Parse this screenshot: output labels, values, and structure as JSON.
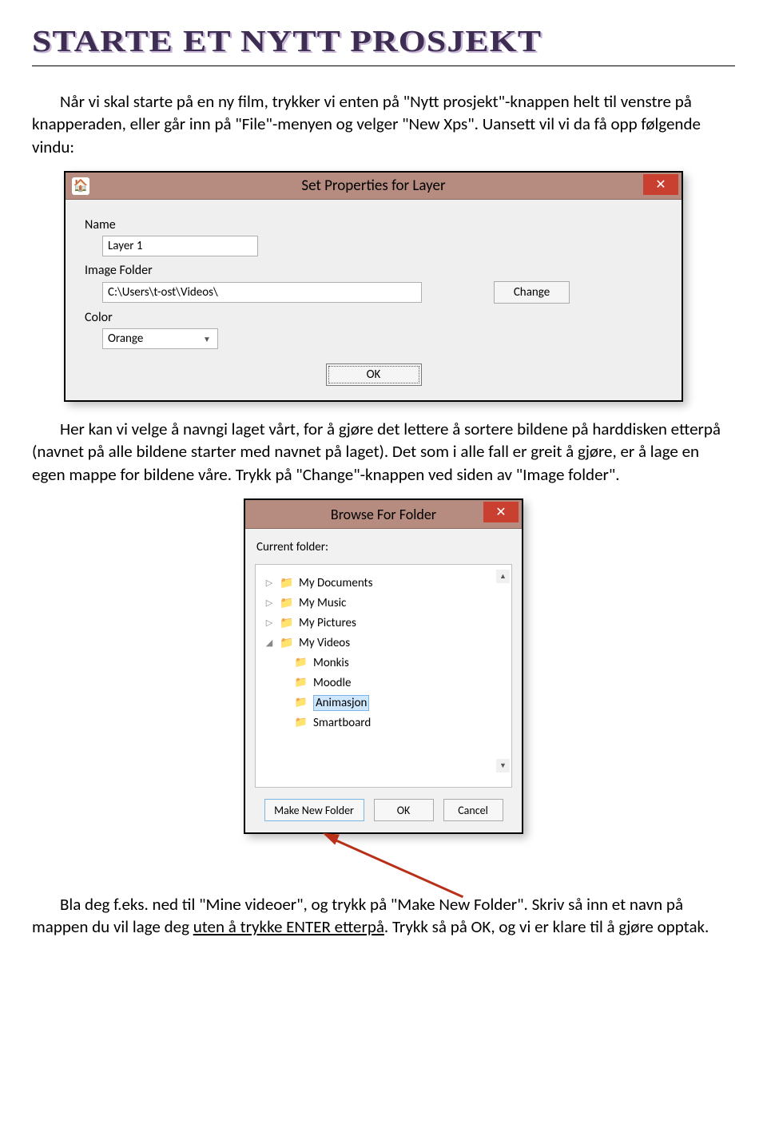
{
  "header": {
    "title": "STARTE ET NYTT PROSJEKT"
  },
  "para1": "Når vi skal starte på en ny film, trykker vi enten på \"Nytt prosjekt\"-knappen helt til venstre på knapperaden, eller går inn på \"File\"-menyen og velger \"New Xps\". Uansett vil vi da få opp følgende vindu:",
  "dialog1": {
    "title": "Set Properties for Layer",
    "close": "✕",
    "name_label": "Name",
    "name_value": "Layer 1",
    "folder_label": "Image Folder",
    "folder_value": "C:\\Users\\t-ost\\Videos\\",
    "change_btn": "Change",
    "color_label": "Color",
    "color_value": "Orange",
    "ok_btn": "OK"
  },
  "para2": "Her kan vi velge å navngi laget vårt, for å gjøre det lettere å sortere bildene på harddisken etterpå (navnet på alle bildene starter med navnet på laget). Det som i alle fall er greit å gjøre, er å lage en egen mappe for bildene våre. Trykk på \"Change\"-knappen ved siden av \"Image folder\".",
  "dialog2": {
    "title": "Browse For Folder",
    "close": "✕",
    "current_label": "Current folder:",
    "items": [
      {
        "exp": "▷",
        "label": "My Documents"
      },
      {
        "exp": "▷",
        "label": "My Music"
      },
      {
        "exp": "▷",
        "label": "My Pictures"
      },
      {
        "exp": "◢",
        "label": "My Videos"
      }
    ],
    "subitems": [
      "Monkis",
      "Moodle",
      "Animasjon",
      "Smartboard"
    ],
    "make_btn": "Make New Folder",
    "ok_btn": "OK",
    "cancel_btn": "Cancel"
  },
  "para3a": "Bla deg f.eks. ned til \"Mine videoer\", og trykk på \"Make New Folder\". Skriv så inn et navn på mappen du vil lage deg ",
  "para3u": "uten å trykke ENTER etterpå",
  "para3b": ". Trykk så på OK, og vi er klare til å gjøre opptak."
}
